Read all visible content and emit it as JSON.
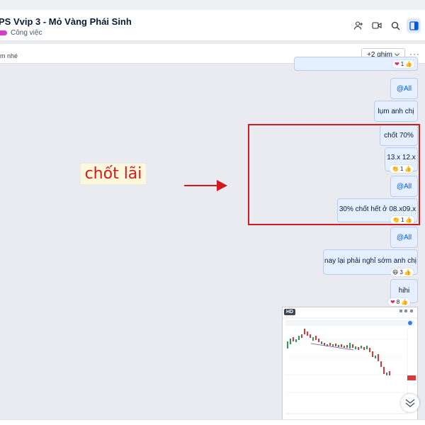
{
  "header": {
    "title": "PS Vvip 3 - Mỏ Vàng Phái Sinh",
    "tag": "Công việc",
    "icons": [
      "add-member-icon",
      "video-call-icon",
      "search-icon",
      "sidebar-toggle-icon"
    ]
  },
  "pinbar": {
    "text": "m nhé",
    "pins_button": "+2 ghim",
    "more": "···"
  },
  "messages": [
    {
      "text": "",
      "reaction_emoji": "heart",
      "reaction_count": "1"
    },
    {
      "text": "@All",
      "mention": true
    },
    {
      "text": "lụm anh chị"
    },
    {
      "text": "chốt 70%"
    },
    {
      "text": "13.x 12.x",
      "reaction_emoji": "clap",
      "reaction_count": "1"
    },
    {
      "text": "@All",
      "mention": true
    },
    {
      "text": "30% chốt hết ở 08.x09.x",
      "reaction_emoji": "clap",
      "reaction_count": "1"
    },
    {
      "text": "@All",
      "mention": true
    },
    {
      "text": "nay lại phải nghỉ sớm anh chị",
      "reaction_emoji": "laugh",
      "reaction_count": "3"
    },
    {
      "text": "hihi",
      "reaction_emoji": "heart",
      "reaction_count": "8"
    }
  ],
  "image_message": {
    "badge": "HD",
    "thumbnail": "stock-chart-screenshot"
  },
  "annotation": {
    "label": "chốt lãi",
    "color": "#d11a20"
  },
  "colors": {
    "bubble": "#e5efff",
    "mention": "#005ae0",
    "tag": "#d63cc9",
    "annotation": "#d11a20"
  }
}
